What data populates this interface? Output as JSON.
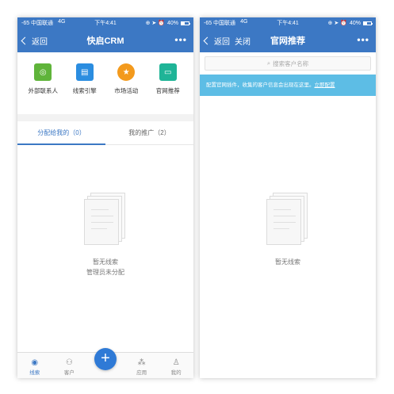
{
  "status_bar": {
    "carrier": "-65 中国联通",
    "network": "4G",
    "time": "下午4:41",
    "status_icons": "⊕ ➤ ⏰",
    "battery": "40%"
  },
  "left": {
    "nav": {
      "back_label": "返回",
      "title": "快启CRM",
      "more": "•••"
    },
    "apps": [
      {
        "label": "外部联系人",
        "color": "#5fb43a",
        "icon": "wechat-icon",
        "glyph": "◎"
      },
      {
        "label": "线索引擎",
        "color": "#2b8de0",
        "icon": "document-search-icon",
        "glyph": "▤"
      },
      {
        "label": "市场活动",
        "color": "#f39a1d",
        "icon": "badge-icon",
        "glyph": "★"
      },
      {
        "label": "官网推荐",
        "color": "#1fb497",
        "icon": "monitor-icon",
        "glyph": "▭"
      }
    ],
    "tabs": [
      {
        "label": "分配给我的（0）",
        "active": true
      },
      {
        "label": "我的推广（2）",
        "active": false
      }
    ],
    "empty": {
      "line1": "暂无线索",
      "line2": "管理员未分配"
    },
    "bottom_nav": [
      {
        "label": "线索",
        "icon": "leads-icon",
        "glyph": "◉",
        "active": true
      },
      {
        "label": "客户",
        "icon": "customers-icon",
        "glyph": "⚇",
        "active": false
      },
      {
        "label": "应用",
        "icon": "apps-icon",
        "glyph": "⁂",
        "active": false
      },
      {
        "label": "我的",
        "icon": "profile-icon",
        "glyph": "♙",
        "active": false
      }
    ],
    "plus": "+"
  },
  "right": {
    "nav": {
      "back_label": "返回",
      "close_label": "关闭",
      "title": "官网推荐",
      "more": "•••"
    },
    "search": {
      "placeholder": "搜索客户名称"
    },
    "notice": {
      "text": "配置官网插件，收集的客户信息会出现在这里。",
      "link": "立即配置"
    },
    "empty": {
      "line1": "暂无线索"
    }
  },
  "colors": {
    "brand": "#3c78c4",
    "notice": "#5dbde5",
    "plus": "#2f7ad6"
  }
}
